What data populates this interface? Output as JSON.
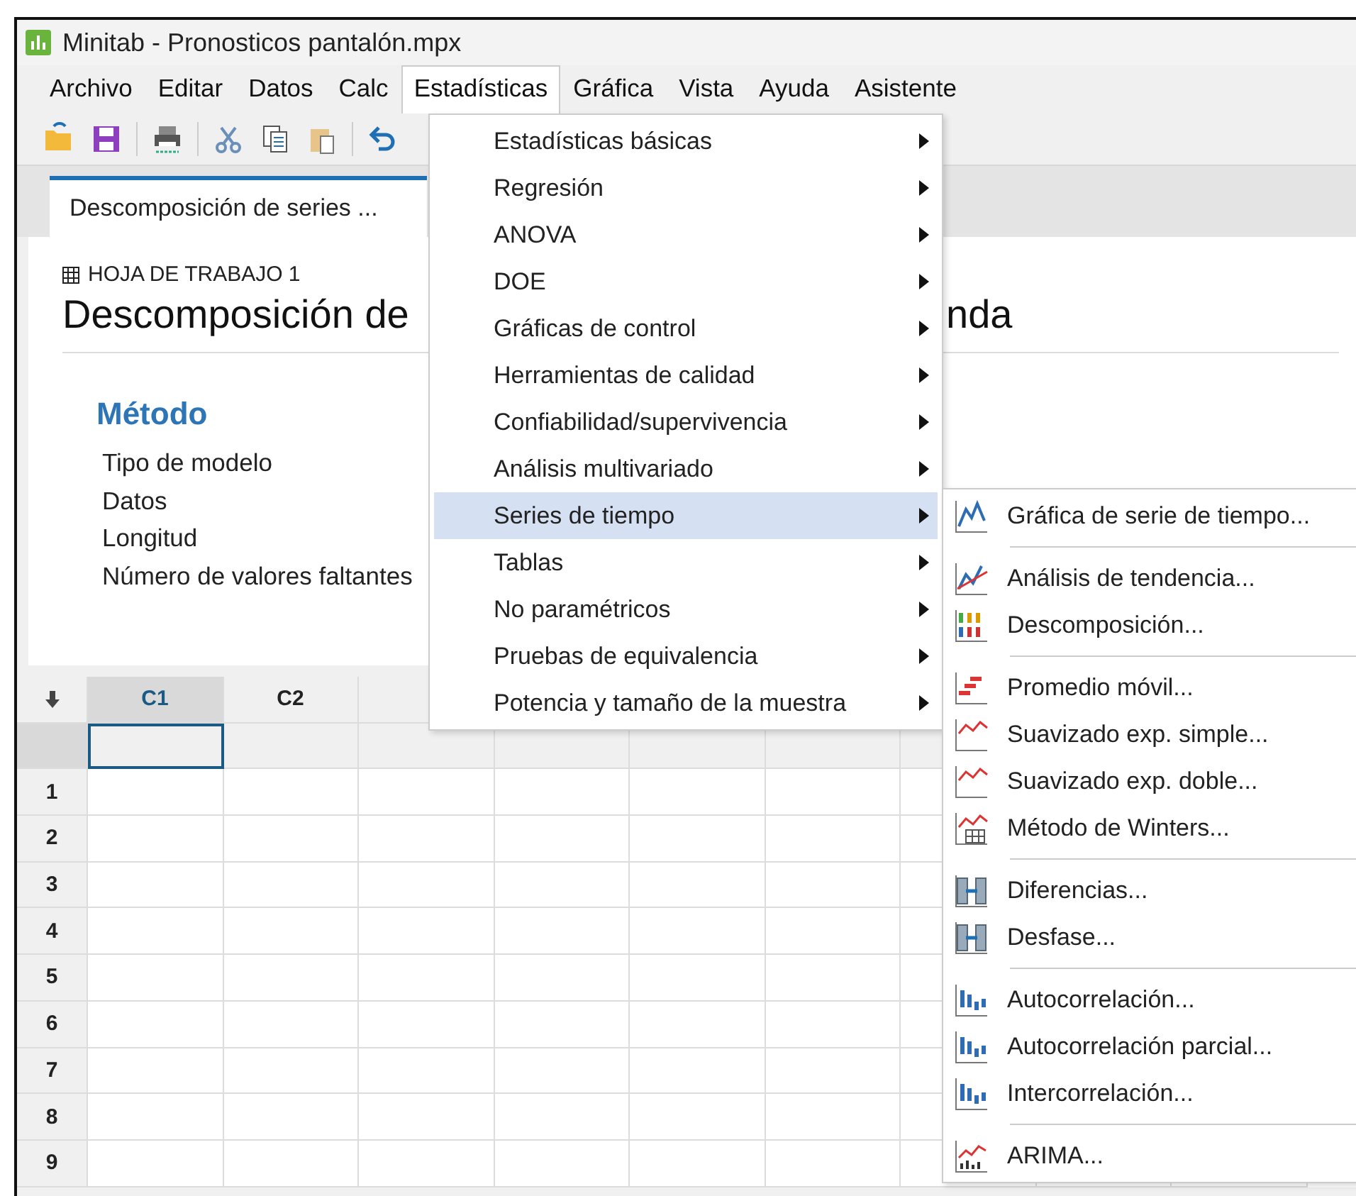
{
  "window": {
    "title": "Minitab - Pronosticos pantalón.mpx"
  },
  "menu_bar": [
    {
      "label": "Archivo",
      "selected": false
    },
    {
      "label": "Editar",
      "selected": false
    },
    {
      "label": "Datos",
      "selected": false
    },
    {
      "label": "Calc",
      "selected": false
    },
    {
      "label": "Estadísticas",
      "selected": true
    },
    {
      "label": "Gráfica",
      "selected": false
    },
    {
      "label": "Vista",
      "selected": false
    },
    {
      "label": "Ayuda",
      "selected": false
    },
    {
      "label": "Asistente",
      "selected": false
    }
  ],
  "document_tab": {
    "label": "Descomposición de series ..."
  },
  "output": {
    "worksheet": "HOJA DE TRABAJO 1",
    "heading_start": "Descomposición de",
    "heading_end": "nda",
    "section": "Método",
    "labels": [
      "Tipo de modelo",
      "Datos",
      "Longitud",
      "Número de valores faltantes"
    ]
  },
  "worksheet": {
    "columns": [
      "C1",
      "C2"
    ],
    "rows": [
      "1",
      "2",
      "3",
      "4",
      "5",
      "6",
      "7",
      "8",
      "9"
    ]
  },
  "stats_menu": [
    {
      "label": "Estadísticas básicas",
      "selected": false
    },
    {
      "label": "Regresión",
      "selected": false
    },
    {
      "label": "ANOVA",
      "selected": false
    },
    {
      "label": "DOE",
      "selected": false
    },
    {
      "label": "Gráficas de control",
      "selected": false
    },
    {
      "label": "Herramientas de calidad",
      "selected": false
    },
    {
      "label": "Confiabilidad/supervivencia",
      "selected": false
    },
    {
      "label": "Análisis multivariado",
      "selected": false
    },
    {
      "label": "Series de tiempo",
      "selected": true
    },
    {
      "label": "Tablas",
      "selected": false
    },
    {
      "label": "No paramétricos",
      "selected": false
    },
    {
      "label": "Pruebas de equivalencia",
      "selected": false
    },
    {
      "label": "Potencia y tamaño de la muestra",
      "selected": false
    }
  ],
  "time_series_menu": [
    [
      "Gráfica de serie de tiempo..."
    ],
    [
      "Análisis de tendencia...",
      "Descomposición..."
    ],
    [
      "Promedio móvil...",
      "Suavizado exp. simple...",
      "Suavizado exp. doble...",
      "Método de Winters..."
    ],
    [
      "Diferencias...",
      "Desfase..."
    ],
    [
      "Autocorrelación...",
      "Autocorrelación parcial...",
      "Intercorrelación..."
    ],
    [
      "ARIMA..."
    ]
  ]
}
